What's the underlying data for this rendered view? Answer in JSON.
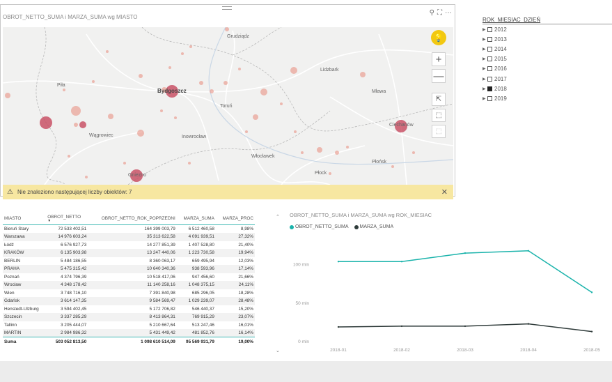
{
  "colors": {
    "accent_teal": "#1ab3ab",
    "dark_series": "#2f3b3a",
    "bubble": "#e8887a",
    "warning_bg": "#f7e7a1",
    "bulb": "#f2c811"
  },
  "map": {
    "title": "OBROT_NETTO_SUMA i MARZA_SUMA wg MIASTO",
    "header_icons": [
      "pin-icon",
      "focus-mode-icon",
      "more-options-icon"
    ],
    "cities": {
      "grudziadz": "Grudziądz",
      "pila": "Piła",
      "bydgoszcz": "Bydgoszcz",
      "torun": "Toruń",
      "lidzbark": "Lidzbark",
      "mlawa": "Mława",
      "ciechanow": "Ciechanów",
      "wagrowiec": "Wągrowiec",
      "inowroclaw": "Inowrocław",
      "wloclawek": "Włocławek",
      "plonsk": "Płońsk",
      "plock": "Płock",
      "gniezno": "Gniezno"
    },
    "controls": {
      "zoom_in": "+",
      "zoom_out": "—"
    },
    "warning": "Nie znaleziono następującej liczby obiektów: 7",
    "warning_icon": "⚠",
    "close": "✕"
  },
  "slicer": {
    "title": "ROK_MIESIAC_DZIEŃ",
    "items": [
      {
        "label": "2012",
        "checked": false
      },
      {
        "label": "2013",
        "checked": false
      },
      {
        "label": "2014",
        "checked": false
      },
      {
        "label": "2015",
        "checked": false
      },
      {
        "label": "2016",
        "checked": false
      },
      {
        "label": "2017",
        "checked": false
      },
      {
        "label": "2018",
        "checked": true
      },
      {
        "label": "2019",
        "checked": false
      }
    ]
  },
  "table": {
    "columns": [
      "MIASTO",
      "OBROT_NETTO",
      "OBROT_NETTO_ROK_POPRZEDNI",
      "MARZA_SUMA",
      "MARZA_PROC"
    ],
    "rows": [
      [
        "Bieruń Stary",
        "72 533 402,51",
        "164 399 003,79",
        "6 512 460,58",
        "8,98%"
      ],
      [
        "Warszawa",
        "14 976 603,24",
        "35 313 622,58",
        "4 091 939,51",
        "27,32%"
      ],
      [
        "Łódź",
        "6 576 927,73",
        "14 277 851,39",
        "1 407 528,80",
        "21,40%"
      ],
      [
        "KRAKÓW",
        "6 135 903,98",
        "13 247 440,06",
        "1 223 730,58",
        "19,94%"
      ],
      [
        "BERLIN",
        "5 484 186,55",
        "8 360 063,17",
        "659 495,94",
        "12,03%"
      ],
      [
        "PRAHA",
        "5 475 315,42",
        "10 640 340,36",
        "938 593,96",
        "17,14%"
      ],
      [
        "Poznań",
        "4 374 796,39",
        "10 518 417,06",
        "947 456,60",
        "21,66%"
      ],
      [
        "Wrocław",
        "4 348 178,42",
        "11 140 258,16",
        "1 048 375,15",
        "24,11%"
      ],
      [
        "Wien",
        "3 748 716,10",
        "7 391 840,98",
        "685 296,05",
        "18,28%"
      ],
      [
        "Gdańsk",
        "3 614 147,35",
        "9 584 569,47",
        "1 029 239,07",
        "28,48%"
      ],
      [
        "Henstedt-Ulzburg",
        "3 594 402,45",
        "5 172 706,82",
        "546 440,37",
        "15,20%"
      ],
      [
        "Szczecin",
        "3 337 285,29",
        "8 413 864,31",
        "769 915,29",
        "23,07%"
      ],
      [
        "Tallinn",
        "3 205 444,07",
        "5 210 667,64",
        "513 247,46",
        "16,01%"
      ],
      [
        "MARTIN",
        "2 984 986,32",
        "5 431 449,42",
        "481 852,76",
        "16,14%"
      ]
    ],
    "total": [
      "Suma",
      "503 052 813,50",
      "1 098 610 514,09",
      "95 569 931,79",
      "19,00%"
    ]
  },
  "chart_data": {
    "type": "line",
    "title": "OBROT_NETTO_SUMA i MARZA_SUMA wg ROK_MIESIAC",
    "categories": [
      "2018-01",
      "2018-02",
      "2018-03",
      "2018-04",
      "2018-05"
    ],
    "series": [
      {
        "name": "OBROT_NETTO_SUMA",
        "color": "#1ab3ab",
        "values": [
          104,
          104,
          115,
          118,
          64
        ]
      },
      {
        "name": "MARZA_SUMA",
        "color": "#2f3b3a",
        "values": [
          19,
          20,
          20,
          23,
          13
        ]
      }
    ],
    "yticks": [
      {
        "value": 0,
        "label": "0 mln"
      },
      {
        "value": 50,
        "label": "50 mln"
      },
      {
        "value": 100,
        "label": "100 mln"
      }
    ],
    "ylim": [
      0,
      135
    ],
    "unit": "mln",
    "grid": false,
    "legend": "top-left"
  }
}
